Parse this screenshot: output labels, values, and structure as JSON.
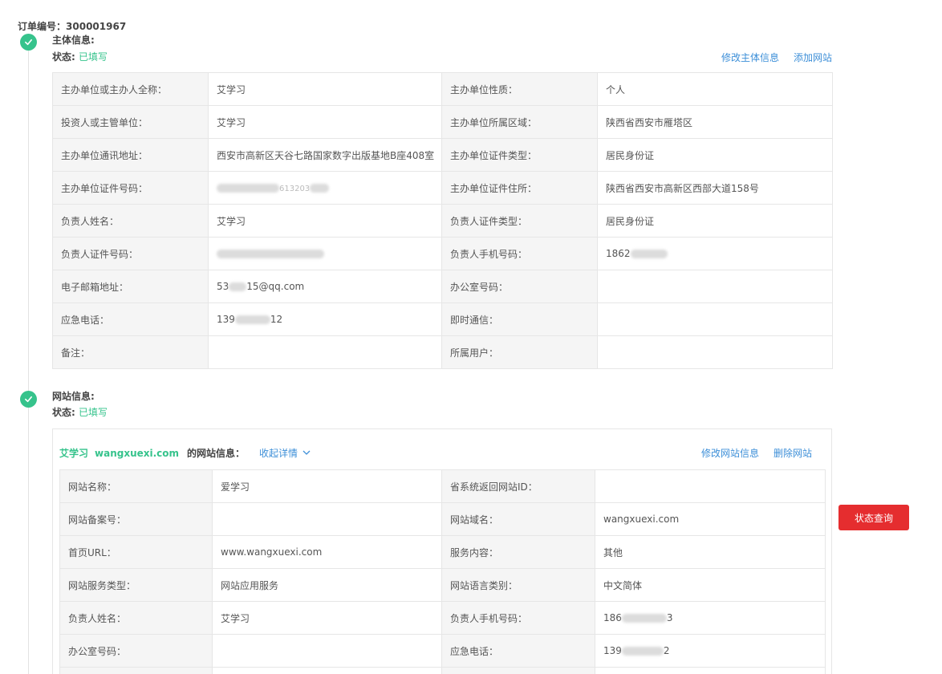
{
  "order": {
    "label": "订单编号：",
    "number": "300001967"
  },
  "subject": {
    "title": "主体信息:",
    "status_label": "状态:",
    "status_value": "已填写",
    "actions": {
      "edit": "修改主体信息",
      "add_site": "添加网站"
    },
    "rows": [
      {
        "l1": "主办单位或主办人全称：",
        "v1": "艾学习",
        "l2": "主办单位性质：",
        "v2": "个人"
      },
      {
        "l1": "投资人或主管单位：",
        "v1": "艾学习",
        "l2": "主办单位所属区域：",
        "v2": "陕西省西安市雁塔区"
      },
      {
        "l1": "主办单位通讯地址：",
        "v1": "西安市高新区天谷七路国家数字出版基地B座408室",
        "l2": "主办单位证件类型：",
        "v2": "居民身份证"
      },
      {
        "l1": "主办单位证件号码：",
        "v1": "613203",
        "l2": "主办单位证件住所：",
        "v2": "陕西省西安市高新区西部大道158号"
      },
      {
        "l1": "负责人姓名：",
        "v1": "艾学习",
        "l2": "负责人证件类型：",
        "v2": "居民身份证"
      },
      {
        "l1": "负责人证件号码：",
        "v1": "",
        "l2": "负责人手机号码：",
        "v2": "1862"
      },
      {
        "l1": "电子邮箱地址：",
        "v1": "53",
        "v1b": "15@qq.com",
        "l2": "办公室号码：",
        "v2": ""
      },
      {
        "l1": "应急电话：",
        "v1": "139",
        "v1b": "12",
        "l2": "即时通信：",
        "v2": ""
      },
      {
        "l1": "备注：",
        "v1": "",
        "l2": "所属用户：",
        "v2": ""
      }
    ]
  },
  "website": {
    "title": "网站信息:",
    "status_label": "状态:",
    "status_value": "已填写",
    "site_name": "艾学习",
    "site_domain": "wangxuexi.com",
    "info_label": "的网站信息：",
    "collapse_label": "收起详情",
    "actions": {
      "edit": "修改网站信息",
      "delete": "删除网站"
    },
    "rows": [
      {
        "l1": "网站名称：",
        "v1": "爱学习",
        "l2": "省系统返回网站ID：",
        "v2": ""
      },
      {
        "l1": "网站备案号：",
        "v1": "",
        "l2": "网站域名：",
        "v2": "wangxuexi.com"
      },
      {
        "l1": "首页URL：",
        "v1": "www.wangxuexi.com",
        "l2": "服务内容：",
        "v2": "其他"
      },
      {
        "l1": "网站服务类型：",
        "v1": "网站应用服务",
        "l2": "网站语言类别：",
        "v2": "中文简体"
      },
      {
        "l1": "负责人姓名：",
        "v1": "艾学习",
        "l2": "负责人手机号码：",
        "v2": "186",
        "v2b": "3"
      },
      {
        "l1": "办公室号码：",
        "v1": "",
        "l2": "应急电话：",
        "v2": "139",
        "v2b": "2"
      }
    ]
  },
  "status_query_button": "状态查询",
  "colors": {
    "green": "#36c38c",
    "link": "#3d8fd8",
    "red": "#e52d2f"
  }
}
